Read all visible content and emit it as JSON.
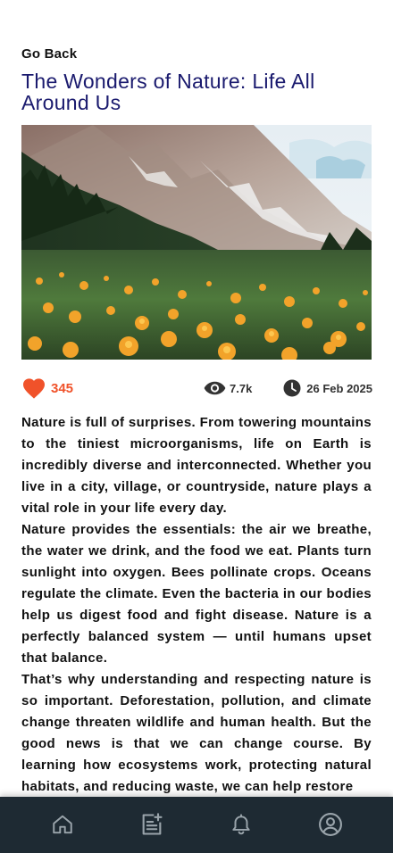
{
  "nav": {
    "back_label": "Go Back"
  },
  "article": {
    "title": "The Wonders of Nature: Life All Around Us",
    "likes": "345",
    "views": "7.7k",
    "date": "26 Feb 2025",
    "paragraphs": [
      "Nature is full of surprises. From towering mountains to the tiniest microorganisms, life on Earth is incredibly diverse and interconnected. Whether you live in a city, village, or countryside, nature plays a vital role in your life every day.",
      "Nature provides the essentials: the air we breathe, the water we drink, and the food we eat. Plants turn sunlight into oxygen. Bees pollinate crops. Oceans regulate the climate. Even the bacteria in our bodies help us digest food and fight disease. Nature is a perfectly balanced system — until humans upset that balance.",
      "That’s why understanding and respecting nature is so important. Deforestation, pollution, and climate change threaten wildlife and human health. But the good news is that we can change course. By learning how ecosystems work, protecting natural habitats, and reducing waste, we can help restore"
    ]
  },
  "icons": {
    "like": "heart-icon",
    "views": "eye-icon",
    "date": "clock-icon",
    "tab_home": "home-icon",
    "tab_articles": "article-add-icon",
    "tab_notifications": "bell-icon",
    "tab_profile": "profile-icon"
  },
  "colors": {
    "title": "#1a1a6e",
    "accent": "#f0522a",
    "bottom_nav_bg": "#1e2a33",
    "bottom_nav_icon": "#9aa4ab"
  }
}
